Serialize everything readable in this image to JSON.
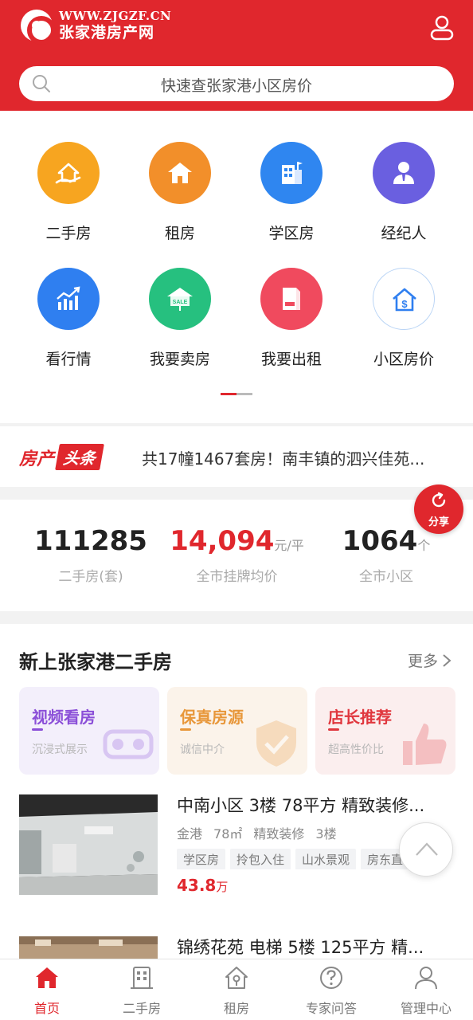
{
  "header": {
    "logo_url": "WWW.ZJGZF.CN",
    "logo_name": "张家港房产网",
    "search_placeholder": "快速查张家港小区房价"
  },
  "quick_menu": [
    {
      "label": "二手房",
      "icon": "house-hand-icon",
      "color": "#f7a520"
    },
    {
      "label": "租房",
      "icon": "rent-house-icon",
      "color": "#f28f2a"
    },
    {
      "label": "学区房",
      "icon": "school-building-icon",
      "color": "#2f86f0"
    },
    {
      "label": "经纪人",
      "icon": "agent-icon",
      "color": "#6a5fe0"
    },
    {
      "label": "看行情",
      "icon": "trend-chart-icon",
      "color": "#2f7ff0"
    },
    {
      "label": "我要卖房",
      "icon": "sale-sign-icon",
      "color": "#26c07f"
    },
    {
      "label": "我要出租",
      "icon": "rent-sign-icon",
      "color": "#f04a5e"
    },
    {
      "label": "小区房价",
      "icon": "price-house-icon",
      "color": "#2f7ff0"
    }
  ],
  "news": {
    "badge1": "房产",
    "badge2": "头条",
    "headline": "共17幢1467套房！南丰镇的泗兴佳苑..."
  },
  "stats": [
    {
      "value": "111285",
      "unit": "",
      "label": "二手房(套)"
    },
    {
      "value": "14,094",
      "unit": "元/平",
      "label": "全市挂牌均价"
    },
    {
      "value": "1064",
      "unit": "个",
      "label": "全市小区"
    }
  ],
  "share_label": "分享",
  "section": {
    "title": "新上张家港二手房",
    "more": "更多"
  },
  "feature_cards": [
    {
      "title": "视频看房",
      "sub": "沉浸式展示",
      "color": "#8b4fd8",
      "bg": "#f3effb"
    },
    {
      "title": "保真房源",
      "sub": "诚信中介",
      "color": "#e8973a",
      "bg": "#fbf3ea"
    },
    {
      "title": "店长推荐",
      "sub": "超高性价比",
      "color": "#e0373e",
      "bg": "#fbeeee"
    }
  ],
  "listings": [
    {
      "title": "中南小区 3楼 78平方 精致装修...",
      "meta": [
        "金港",
        "78㎡",
        "精致装修",
        "3楼"
      ],
      "tags": [
        "学区房",
        "拎包入住",
        "山水景观",
        "房东直售"
      ],
      "price": "43.8",
      "price_unit": "万"
    },
    {
      "title": "锦绣花苑 电梯 5楼 125平方 精...",
      "meta": [],
      "tags": [],
      "price": "",
      "price_unit": ""
    }
  ],
  "tabbar": [
    {
      "label": "首页",
      "active": true
    },
    {
      "label": "二手房",
      "active": false
    },
    {
      "label": "租房",
      "active": false
    },
    {
      "label": "专家问答",
      "active": false
    },
    {
      "label": "管理中心",
      "active": false
    }
  ],
  "colors": {
    "brand_red": "#e0272d"
  }
}
